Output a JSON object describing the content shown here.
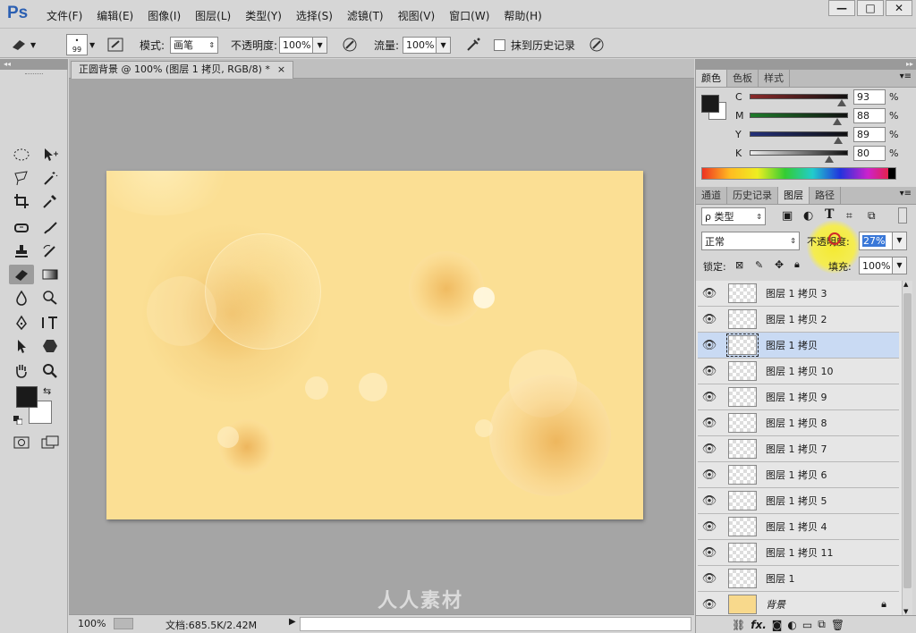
{
  "app": {
    "logo": "Ps"
  },
  "menu": [
    "文件(F)",
    "编辑(E)",
    "图像(I)",
    "图层(L)",
    "类型(Y)",
    "选择(S)",
    "滤镜(T)",
    "视图(V)",
    "窗口(W)",
    "帮助(H)"
  ],
  "window_controls": [
    "—",
    "□",
    "✕"
  ],
  "options": {
    "brush_size": "99",
    "mode_label": "模式:",
    "mode_value": "画笔",
    "opacity_label": "不透明度:",
    "opacity_value": "100%",
    "flow_label": "流量:",
    "flow_value": "100%",
    "erase_history_label": "抹到历史记录"
  },
  "document": {
    "tab_title": "正圆背景 @ 100% (图层 1 拷贝, RGB/8) *",
    "tab_close": "×",
    "zoom": "100%",
    "doc_info": "文档:685.5K/2.42M",
    "canvas_color": "#fbdf94"
  },
  "colors": {
    "foreground": "#1a1a1a",
    "background": "#ffffff"
  },
  "color_panel": {
    "tabs": [
      "颜色",
      "色板",
      "样式"
    ],
    "active_tab": 0,
    "channels": [
      {
        "label": "C",
        "value": "93",
        "fraction": 0.93,
        "color": "#3aa9c9"
      },
      {
        "label": "M",
        "value": "88",
        "fraction": 0.88,
        "color": "#b83a7c"
      },
      {
        "label": "Y",
        "value": "89",
        "fraction": 0.89,
        "color": "#c4b83a"
      },
      {
        "label": "K",
        "value": "80",
        "fraction": 0.8,
        "color": "#333333"
      }
    ],
    "unit": "%"
  },
  "layers_panel": {
    "tabs": [
      "通道",
      "历史记录",
      "图层",
      "路径"
    ],
    "active_tab": 2,
    "filter_label": "ρ 类型",
    "blend_mode": "正常",
    "opacity_label": "不透明度:",
    "opacity_value": "27%",
    "lock_label": "锁定:",
    "fill_label": "填充:",
    "fill_value": "100%",
    "layers": [
      {
        "name": "图层 1 拷贝 3",
        "selected": false
      },
      {
        "name": "图层 1 拷贝 2",
        "selected": false
      },
      {
        "name": "图层 1 拷贝",
        "selected": true
      },
      {
        "name": "图层 1 拷贝 10",
        "selected": false
      },
      {
        "name": "图层 1 拷贝 9",
        "selected": false
      },
      {
        "name": "图层 1 拷贝 8",
        "selected": false
      },
      {
        "name": "图层 1 拷贝 7",
        "selected": false
      },
      {
        "name": "图层 1 拷贝 6",
        "selected": false
      },
      {
        "name": "图层 1 拷贝 5",
        "selected": false
      },
      {
        "name": "图层 1 拷贝 4",
        "selected": false
      },
      {
        "name": "图层 1 拷贝 11",
        "selected": false
      },
      {
        "name": "图层 1",
        "selected": false
      },
      {
        "name": "背景",
        "selected": false,
        "background": true
      }
    ]
  },
  "watermark": "人人素材"
}
